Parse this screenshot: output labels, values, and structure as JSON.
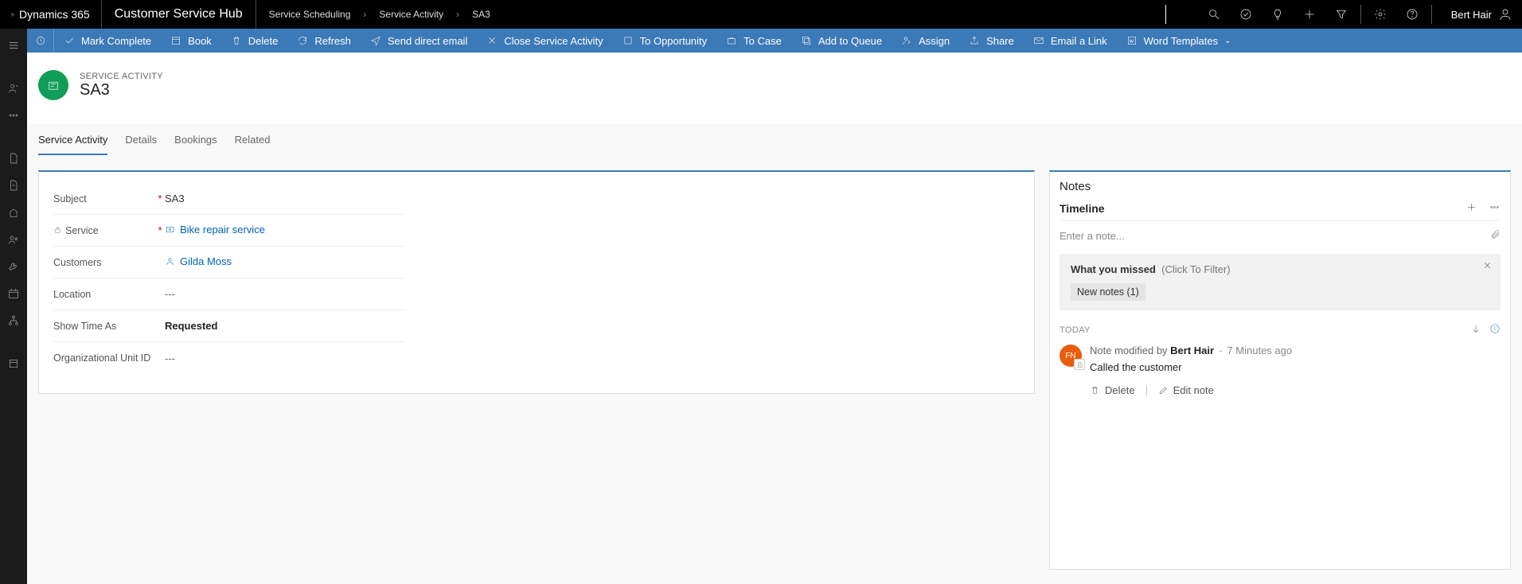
{
  "top": {
    "product": "Dynamics 365",
    "hub": "Customer Service Hub",
    "breadcrumb": [
      "Service Scheduling",
      "Service Activity",
      "SA3"
    ],
    "user": "Bert Hair"
  },
  "cmd": {
    "mark_complete": "Mark Complete",
    "book": "Book",
    "delete": "Delete",
    "refresh": "Refresh",
    "send_email": "Send direct email",
    "close_activity": "Close Service Activity",
    "to_opportunity": "To Opportunity",
    "to_case": "To Case",
    "add_queue": "Add to Queue",
    "assign": "Assign",
    "share": "Share",
    "email_link": "Email a Link",
    "word_templates": "Word Templates"
  },
  "record": {
    "type_label": "SERVICE ACTIVITY",
    "name": "SA3"
  },
  "tabs": {
    "service_activity": "Service Activity",
    "details": "Details",
    "bookings": "Bookings",
    "related": "Related"
  },
  "form": {
    "subject_label": "Subject",
    "subject_value": "SA3",
    "service_label": "Service",
    "service_value": "Bike repair service",
    "customers_label": "Customers",
    "customers_value": "Gilda Moss",
    "location_label": "Location",
    "location_value": "---",
    "showtime_label": "Show Time As",
    "showtime_value": "Requested",
    "orgunit_label": "Organizational Unit ID",
    "orgunit_value": "---"
  },
  "notes": {
    "section_title": "Notes",
    "timeline_label": "Timeline",
    "input_placeholder": "Enter a note...",
    "missed_title": "What you missed",
    "missed_hint": "(Click To Filter)",
    "chip_new_notes": "New notes (1)",
    "today_label": "TODAY",
    "entry": {
      "prefix": "Note modified by ",
      "author": "Bert Hair",
      "time": "7 Minutes ago",
      "text": "Called the customer",
      "avatar_initials": "FN"
    },
    "actions": {
      "delete": "Delete",
      "edit": "Edit note"
    }
  }
}
